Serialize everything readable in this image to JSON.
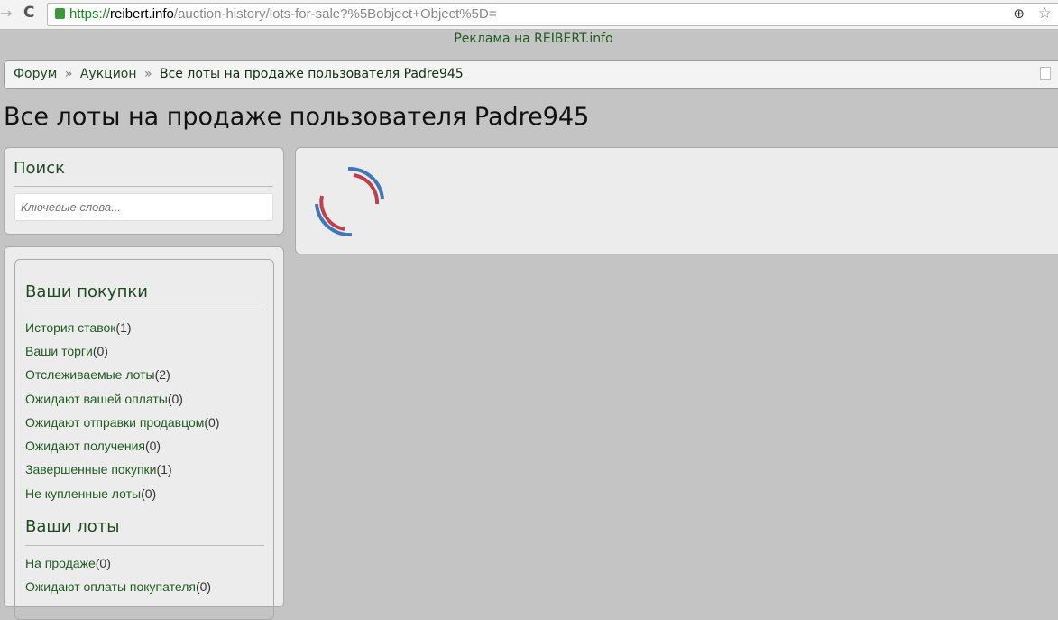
{
  "browser": {
    "url_scheme": "https://",
    "url_host": "reibert.info",
    "url_path": "/auction-history/lots-for-sale?%5Bobject+Object%5D="
  },
  "ad": "Реклама на REIBERT.info",
  "breadcrumb": {
    "items": [
      "Форум",
      "Аукцион"
    ],
    "separator": "»",
    "current": "Все лоты на продаже пользователя Padre945"
  },
  "page_title": "Все лоты на продаже пользователя Padre945",
  "search": {
    "title": "Поиск",
    "placeholder": "Ключевые слова..."
  },
  "purchases": {
    "title": "Ваши покупки",
    "items": [
      {
        "label": "История ставок",
        "count": "(1)"
      },
      {
        "label": "Ваши торги",
        "count": "(0)"
      },
      {
        "label": "Отслеживаемые лоты",
        "count": "(2)"
      },
      {
        "label": "Ожидают вашей оплаты",
        "count": "(0)"
      },
      {
        "label": "Ожидают отправки продавцом",
        "count": "(0)"
      },
      {
        "label": "Ожидают получения",
        "count": "(0)"
      },
      {
        "label": "Завершенные покупки",
        "count": "(1)"
      },
      {
        "label": "Не купленные лоты",
        "count": "(0)"
      }
    ]
  },
  "lots": {
    "title": "Ваши лоты",
    "items": [
      {
        "label": "На продаже",
        "count": "(0)"
      },
      {
        "label": "Ожидают оплаты покупателя",
        "count": "(0)"
      }
    ]
  }
}
